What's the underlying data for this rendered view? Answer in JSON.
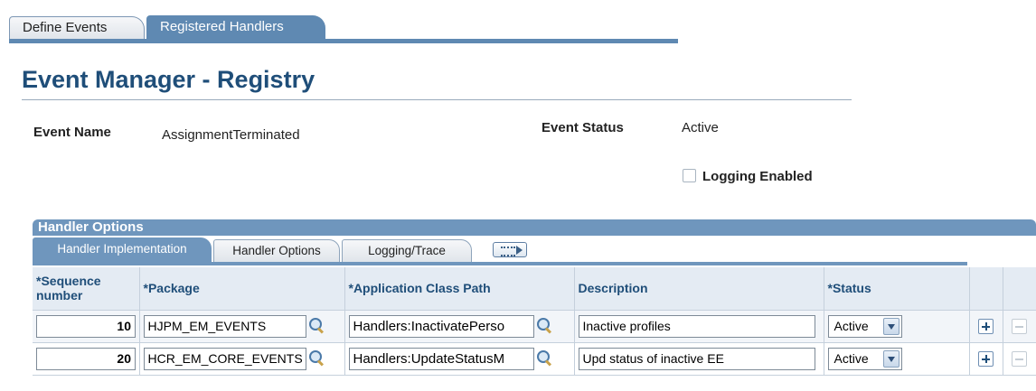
{
  "tabs": [
    "Define Events",
    "Registered Handlers"
  ],
  "page_title": "Event Manager - Registry",
  "fields": {
    "event_name_label": "Event Name",
    "event_name_value": "AssignmentTerminated",
    "event_status_label": "Event Status",
    "event_status_value": "Active",
    "logging_label": "Logging Enabled",
    "logging_checked": false
  },
  "grid": {
    "title": "Handler Options",
    "tabs": [
      "Handler Implementation",
      "Handler Options",
      "Logging/Trace"
    ],
    "columns": {
      "seq_line1": "*Sequence",
      "seq_line2": "number",
      "package": "*Package",
      "class_path": "*Application Class Path",
      "description": "Description",
      "status": "*Status"
    },
    "rows": [
      {
        "seq": "10",
        "package": "HJPM_EM_EVENTS",
        "class_path": "Handlers:InactivatePerso",
        "description": "Inactive profiles",
        "status": "Active"
      },
      {
        "seq": "20",
        "package": "HCR_EM_CORE_EVENTS",
        "class_path": "Handlers:UpdateStatusM",
        "description": "Upd status of inactive EE",
        "status": "Active"
      }
    ]
  },
  "colors": {
    "accent": "#5f89b2",
    "title": "#1f4e79"
  }
}
